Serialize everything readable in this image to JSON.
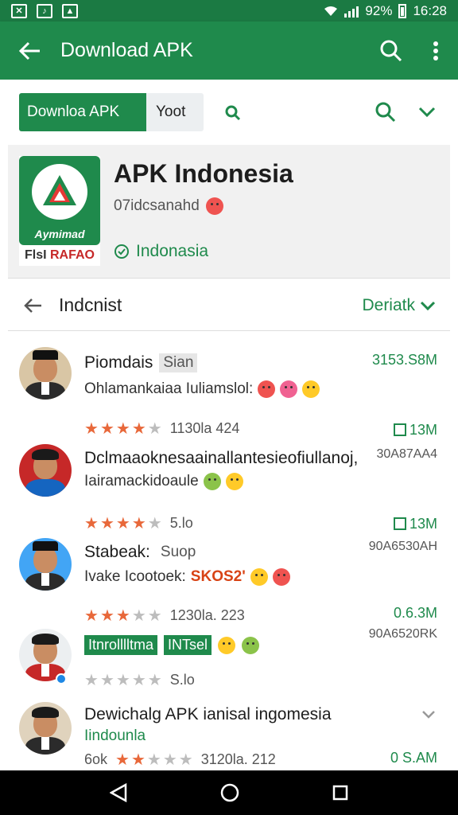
{
  "status_bar": {
    "battery": "92%",
    "time": "16:28"
  },
  "app_bar": {
    "title": "Download APK"
  },
  "search": {
    "active_chip": "Downloa APK",
    "secondary_chip": "Yoot"
  },
  "app_header": {
    "title": "APK Indonesia",
    "subtitle": "07idcsanahd",
    "icon_label": "Aymimad",
    "icon_sublabel_a": "FlsI",
    "icon_sublabel_b": "RAFAO",
    "country": "Indonasia"
  },
  "filter_bar": {
    "label": "Indcnist",
    "sort_label": "Deriatk"
  },
  "list": [
    {
      "name": "Piomdais",
      "tag": "Sian",
      "desc": "Ohlamankaiaa Iuliamslol:",
      "rating_text": "1130la 424",
      "stars": 4,
      "size": "3153.S8M",
      "code": ""
    },
    {
      "name": "Dclmaaoknesaainallantesieofiullanoj,",
      "name2": "Iairamackidoaule",
      "size": "13M",
      "code": "30A87AA4",
      "rating_text": "5.lo",
      "stars": 4
    },
    {
      "name": "Stabeak:",
      "tag": "Suop",
      "desc": "Ivake Icootoek:",
      "desc_red": "SKOS2'",
      "size": "13M",
      "code": "90A6530AH",
      "rating_text": "1230la. 223",
      "stars": 3
    },
    {
      "name_tag1": "Itnrolllltma",
      "name_tag2": "INTsel",
      "size": "0.6.3M",
      "code": "90A6520RK",
      "rating_text": "S.lo",
      "stars": 0
    },
    {
      "name": "Dewichalg APK ianisal ingomesia",
      "name2": "Iindounla",
      "rating_prefix": "6ok",
      "rating_text": "3120la. 212",
      "stars": 2,
      "size": "0 S.AM"
    }
  ]
}
